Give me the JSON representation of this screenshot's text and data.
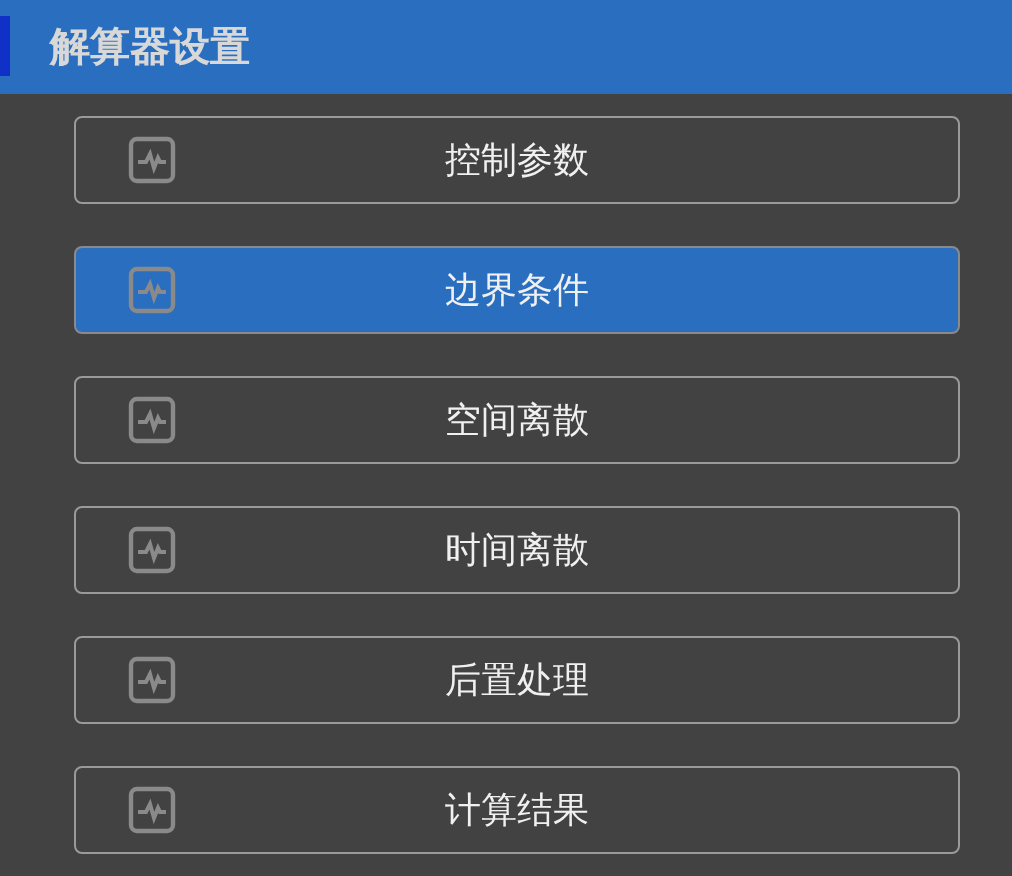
{
  "header": {
    "title": "解算器设置"
  },
  "items": [
    {
      "label": "控制参数",
      "selected": false
    },
    {
      "label": "边界条件",
      "selected": true
    },
    {
      "label": "空间离散",
      "selected": false
    },
    {
      "label": "时间离散",
      "selected": false
    },
    {
      "label": "后置处理",
      "selected": false
    },
    {
      "label": "计算结果",
      "selected": false
    }
  ]
}
